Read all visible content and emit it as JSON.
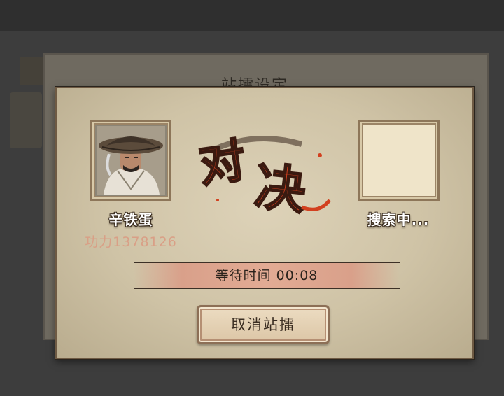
{
  "background": {
    "title": "站擂设定"
  },
  "dialog": {
    "vs_text": "对决",
    "player_left": {
      "name": "辛铁蛋",
      "power": "功力1378126"
    },
    "player_right": {
      "name": "搜索中..."
    },
    "timer": {
      "label": "等待时间 00:08"
    },
    "cancel_button": "取消站擂"
  },
  "colors": {
    "accent_red": "#d2401f",
    "power_text": "#d99f86",
    "parchment": "#d6cab0"
  }
}
